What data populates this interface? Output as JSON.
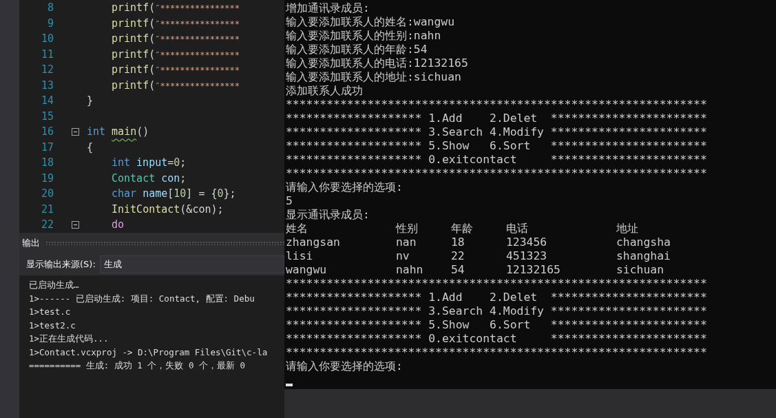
{
  "editor": {
    "lines": [
      {
        "number": "8",
        "foldable": false,
        "indented": true,
        "tokens": [
          {
            "kind": "function",
            "text": "printf"
          },
          {
            "kind": "punct",
            "text": "("
          },
          {
            "kind": "string",
            "text": "″****************"
          }
        ]
      },
      {
        "number": "9",
        "foldable": false,
        "indented": true,
        "tokens": [
          {
            "kind": "function",
            "text": "printf"
          },
          {
            "kind": "punct",
            "text": "("
          },
          {
            "kind": "string",
            "text": "″****************"
          }
        ]
      },
      {
        "number": "10",
        "foldable": false,
        "indented": true,
        "tokens": [
          {
            "kind": "function",
            "text": "printf"
          },
          {
            "kind": "punct",
            "text": "("
          },
          {
            "kind": "string",
            "text": "″****************"
          }
        ]
      },
      {
        "number": "11",
        "foldable": false,
        "indented": true,
        "tokens": [
          {
            "kind": "function",
            "text": "printf"
          },
          {
            "kind": "punct",
            "text": "("
          },
          {
            "kind": "string",
            "text": "″****************"
          }
        ]
      },
      {
        "number": "12",
        "foldable": false,
        "indented": true,
        "tokens": [
          {
            "kind": "function",
            "text": "printf"
          },
          {
            "kind": "punct",
            "text": "("
          },
          {
            "kind": "string",
            "text": "″****************"
          }
        ]
      },
      {
        "number": "13",
        "foldable": false,
        "indented": true,
        "tokens": [
          {
            "kind": "function",
            "text": "printf"
          },
          {
            "kind": "punct",
            "text": "("
          },
          {
            "kind": "string",
            "text": "″****************"
          }
        ]
      },
      {
        "number": "14",
        "foldable": false,
        "indented": false,
        "tokens": [
          {
            "kind": "punct",
            "text": "}"
          }
        ]
      },
      {
        "number": "15",
        "foldable": false
      },
      {
        "number": "16",
        "foldable": true,
        "indented": false,
        "tokens": [
          {
            "kind": "keyword",
            "text": "int"
          },
          {
            "kind": "function",
            "text": "main",
            "warning": true
          },
          {
            "kind": "punct",
            "text": "()"
          }
        ]
      },
      {
        "number": "17",
        "foldable": false,
        "indented": false,
        "tokens": [
          {
            "kind": "punct",
            "text": "{"
          }
        ]
      },
      {
        "number": "18",
        "foldable": false,
        "indented": true,
        "tokens": [
          {
            "kind": "keyword",
            "text": "int"
          },
          {
            "kind": "variable",
            "text": "input"
          },
          {
            "kind": "punct",
            "text": "="
          },
          {
            "kind": "number",
            "text": "0"
          },
          {
            "kind": "punct",
            "text": ";"
          }
        ]
      },
      {
        "number": "19",
        "foldable": false,
        "indented": true,
        "tokens": [
          {
            "kind": "type",
            "text": "Contact"
          },
          {
            "kind": "variable",
            "text": "con"
          },
          {
            "kind": "punct",
            "text": ";"
          }
        ]
      },
      {
        "number": "20",
        "foldable": false,
        "indented": true,
        "tokens": [
          {
            "kind": "keyword",
            "text": "char"
          },
          {
            "kind": "variable",
            "text": "name"
          },
          {
            "kind": "punct",
            "text": "["
          },
          {
            "kind": "number",
            "text": "10"
          },
          {
            "kind": "punct",
            "text": "] = {"
          },
          {
            "kind": "number",
            "text": "0"
          },
          {
            "kind": "punct",
            "text": "};"
          }
        ]
      },
      {
        "number": "21",
        "foldable": false,
        "indented": true,
        "tokens": [
          {
            "kind": "function",
            "text": "InitContact"
          },
          {
            "kind": "punct",
            "text": "(&con);"
          }
        ]
      },
      {
        "number": "22",
        "foldable": true,
        "indented": true,
        "tokens": [
          {
            "kind": "control",
            "text": "do"
          }
        ]
      }
    ]
  },
  "output_panel": {
    "title": "输出",
    "source_label": "显示输出来源(S):",
    "source_value": "生成",
    "lines": [
      "已启动生成…",
      "1>------ 已启动生成: 项目: Contact, 配置: Debu",
      "1>test.c",
      "1>test2.c",
      "1>正在生成代码...",
      "1>Contact.vcxproj -> D:\\Program Files\\Git\\c-la",
      "========== 生成: 成功 1 个，失败 0 个，最新 0"
    ]
  },
  "console": {
    "lines": [
      {
        "kind": "text",
        "text": "增加通讯录成员:"
      },
      {
        "kind": "text",
        "text": "输入要添加联系人的姓名:wangwu"
      },
      {
        "kind": "text",
        "text": "输入要添加联系人的性别:nahn"
      },
      {
        "kind": "text",
        "text": "输入要添加联系人的年龄:54"
      },
      {
        "kind": "text",
        "text": "输入要添加联系人的电话:12132165"
      },
      {
        "kind": "text",
        "text": "输入要添加联系人的地址:sichuan"
      },
      {
        "kind": "text",
        "text": "添加联系人成功"
      },
      {
        "kind": "text",
        "text": "**************************************************************"
      },
      {
        "kind": "text",
        "text": "******************** 1.Add    2.Delet  ***********************"
      },
      {
        "kind": "text",
        "text": "******************** 3.Search 4.Modify ***********************"
      },
      {
        "kind": "text",
        "text": "******************** 5.Show   6.Sort   ***********************"
      },
      {
        "kind": "text",
        "text": "******************** 0.exitcontact     ***********************"
      },
      {
        "kind": "text",
        "text": "**************************************************************"
      },
      {
        "kind": "text",
        "text": "请输入你要选择的选项:"
      },
      {
        "kind": "text",
        "text": "5"
      },
      {
        "kind": "text",
        "text": "显示通讯录成员:"
      },
      {
        "kind": "row",
        "cells": [
          "姓名",
          "性别",
          "年龄",
          "电话",
          "地址"
        ]
      },
      {
        "kind": "row",
        "cells": [
          "zhangsan",
          "nan",
          "18",
          "123456",
          "changsha"
        ]
      },
      {
        "kind": "row",
        "cells": [
          "lisi",
          "nv",
          "22",
          "451323",
          "shanghai"
        ]
      },
      {
        "kind": "row",
        "cells": [
          "wangwu",
          "nahn",
          "54",
          "12132165",
          "sichuan"
        ]
      },
      {
        "kind": "text",
        "text": "**************************************************************"
      },
      {
        "kind": "text",
        "text": "******************** 1.Add    2.Delet  ***********************"
      },
      {
        "kind": "text",
        "text": "******************** 3.Search 4.Modify ***********************"
      },
      {
        "kind": "text",
        "text": "******************** 5.Show   6.Sort   ***********************"
      },
      {
        "kind": "text",
        "text": "******************** 0.exitcontact     ***********************"
      },
      {
        "kind": "text",
        "text": "**************************************************************"
      },
      {
        "kind": "text",
        "text": "请输入你要选择的选项:"
      }
    ]
  }
}
